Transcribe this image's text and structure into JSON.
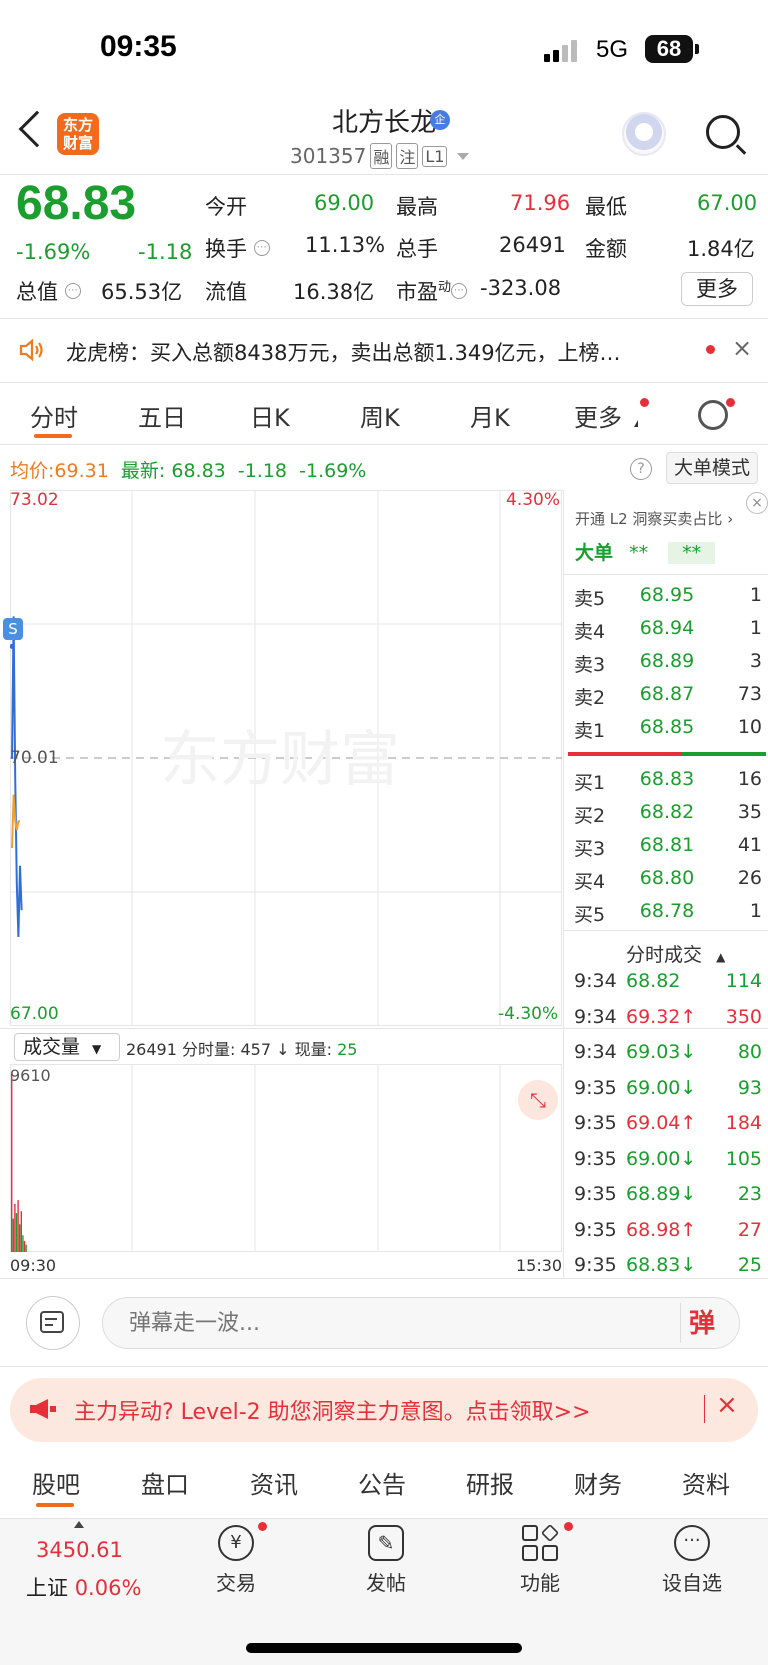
{
  "status_bar": {
    "time": "09:35",
    "network": "5G",
    "battery": "68"
  },
  "header": {
    "app_logo": "东方\n财富",
    "stock_name": "北方长龙",
    "verify_badge": "企",
    "stock_code": "301357",
    "tags": [
      "融",
      "注",
      "L1"
    ]
  },
  "quote": {
    "price": "68.83",
    "change_pct": "-1.69%",
    "change": "-1.18",
    "fields": [
      {
        "label": "今开",
        "value": "69.00",
        "color": "green"
      },
      {
        "label": "最高",
        "value": "71.96",
        "color": "red"
      },
      {
        "label": "最低",
        "value": "67.00",
        "color": "green"
      },
      {
        "label": "换手",
        "value": "11.13%",
        "color": "black"
      },
      {
        "label": "总手",
        "value": "26491",
        "color": "black"
      },
      {
        "label": "金额",
        "value": "1.84亿",
        "color": "black"
      },
      {
        "label": "总值",
        "value": "65.53亿",
        "color": "black"
      },
      {
        "label": "流值",
        "value": "16.38亿",
        "color": "black"
      },
      {
        "label": "市盈",
        "label_sup": "动",
        "value": "-323.08",
        "color": "black"
      }
    ],
    "more_button": "更多"
  },
  "notice": {
    "text": "龙虎榜：买入总额8438万元，卖出总额1.349亿元，上榜…",
    "close": "×"
  },
  "period_tabs": [
    "分时",
    "五日",
    "日K",
    "周K",
    "月K",
    "更多"
  ],
  "intraday": {
    "avg_label": "均价:",
    "avg_value": "69.31",
    "latest_label": "最新:",
    "latest_value": "68.83",
    "latest_change": "-1.18",
    "latest_pct": "-1.69%",
    "help": "?",
    "big_order_mode": "大单模式",
    "y_high": "73.02",
    "y_mid": "70.01",
    "y_low": "67.00",
    "pct_high": "4.30%",
    "pct_low": "-4.30%",
    "watermark": "东方财富",
    "signal_badge": "S"
  },
  "volume": {
    "selector": "成交量",
    "total": "26491",
    "minute_label": "分时量:",
    "minute_value": "457 ↓",
    "current_label": "现量:",
    "current_value": "25",
    "y_max": "9610",
    "time_start": "09:30",
    "time_end": "15:30"
  },
  "order_book": {
    "promo": "开通 L2 洞察买卖占比 ›",
    "big_label": "大单",
    "big_value": "**",
    "big_value2": "**",
    "asks": [
      {
        "label": "卖5",
        "price": "68.95",
        "vol": "1"
      },
      {
        "label": "卖4",
        "price": "68.94",
        "vol": "1"
      },
      {
        "label": "卖3",
        "price": "68.89",
        "vol": "3"
      },
      {
        "label": "卖2",
        "price": "68.87",
        "vol": "73"
      },
      {
        "label": "卖1",
        "price": "68.85",
        "vol": "10"
      }
    ],
    "bids": [
      {
        "label": "买1",
        "price": "68.83",
        "vol": "16"
      },
      {
        "label": "买2",
        "price": "68.82",
        "vol": "35"
      },
      {
        "label": "买3",
        "price": "68.81",
        "vol": "41"
      },
      {
        "label": "买4",
        "price": "68.80",
        "vol": "26"
      },
      {
        "label": "买5",
        "price": "68.78",
        "vol": "1"
      }
    ],
    "ticks_title": "分时成交",
    "ticks": [
      {
        "time": "9:34",
        "price": "68.82",
        "vol": "114",
        "dir": "",
        "color": "green"
      },
      {
        "time": "9:34",
        "price": "69.32↑",
        "vol": "350",
        "dir": "up",
        "color": "red"
      },
      {
        "time": "9:34",
        "price": "69.03↓",
        "vol": "80",
        "dir": "down",
        "color": "green"
      },
      {
        "time": "9:35",
        "price": "69.00↓",
        "vol": "93",
        "dir": "down",
        "color": "green"
      },
      {
        "time": "9:35",
        "price": "69.04↑",
        "vol": "184",
        "dir": "up",
        "color": "red"
      },
      {
        "time": "9:35",
        "price": "69.00↓",
        "vol": "105",
        "dir": "down",
        "color": "green"
      },
      {
        "time": "9:35",
        "price": "68.89↓",
        "vol": "23",
        "dir": "down",
        "color": "green"
      },
      {
        "time": "9:35",
        "price": "68.98↑",
        "vol": "27",
        "dir": "up",
        "color": "red"
      },
      {
        "time": "9:35",
        "price": "68.83↓",
        "vol": "25",
        "dir": "down",
        "color": "green"
      }
    ]
  },
  "danmaku": {
    "placeholder": "弹幕走一波...",
    "button": "弹"
  },
  "promo_banner": {
    "text": "主力异动? Level-2 助您洞察主力意图。点击领取>>",
    "close": "×"
  },
  "section_tabs": [
    "股吧",
    "盘口",
    "资讯",
    "公告",
    "研报",
    "财务",
    "资料"
  ],
  "bottom_nav": {
    "index_value": "3450.61",
    "index_name": "上证",
    "index_pct": "0.06%",
    "items": [
      "交易",
      "发帖",
      "功能",
      "设自选"
    ]
  },
  "chart_data": {
    "type": "line",
    "title": "",
    "xlabel": "",
    "ylabel": "",
    "ylim": [
      67.0,
      73.02
    ],
    "x_range": [
      "09:30",
      "15:30"
    ],
    "series": [
      {
        "name": "",
        "color": "#2f6fd6",
        "values": [
          70.0,
          71.6,
          69.8,
          68.6,
          68.0,
          68.8,
          68.3
        ]
      },
      {
        "name": "",
        "color": "#f0a030",
        "values": [
          69.0,
          69.6,
          69.3,
          69.2,
          69.3,
          69.3
        ]
      }
    ],
    "volume_ymax": 9610,
    "volume_bars": [
      9610,
      1800,
      2600,
      2100,
      2800,
      1500,
      2200,
      900,
      600,
      400
    ]
  }
}
